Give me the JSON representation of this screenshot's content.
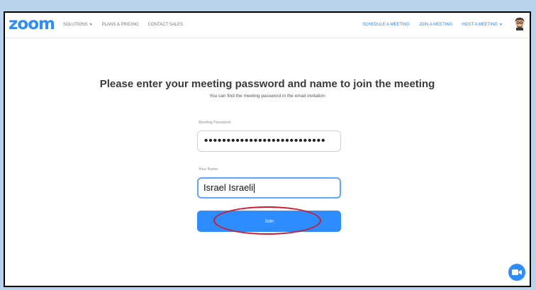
{
  "header": {
    "logo_text": "zoom",
    "nav_left": [
      {
        "label": "SOLUTIONS",
        "has_dropdown": true
      },
      {
        "label": "PLANS & PRICING",
        "has_dropdown": false
      },
      {
        "label": "CONTACT SALES",
        "has_dropdown": false
      }
    ],
    "nav_right": [
      {
        "label": "SCHEDULE A MEETING",
        "has_dropdown": false
      },
      {
        "label": "JOIN A MEETING",
        "has_dropdown": false
      },
      {
        "label": "HOST A MEETING",
        "has_dropdown": true
      }
    ],
    "avatar_icon": "user-avatar"
  },
  "main": {
    "title": "Please enter your meeting password and name to join the meeting",
    "subtitle": "You can find the meeting password in the email invitation",
    "password_field": {
      "label": "Meeting Password",
      "value": "•••••••••••••••••••••••••••"
    },
    "name_field": {
      "label": "Your Name",
      "value": "Israel Israeli"
    },
    "join_button_label": "Join"
  },
  "colors": {
    "brand": "#2d8cff",
    "highlight": "#d11a2a",
    "background": "#b9d3ec"
  },
  "icons": {
    "floating_button": "video-camera-icon"
  }
}
